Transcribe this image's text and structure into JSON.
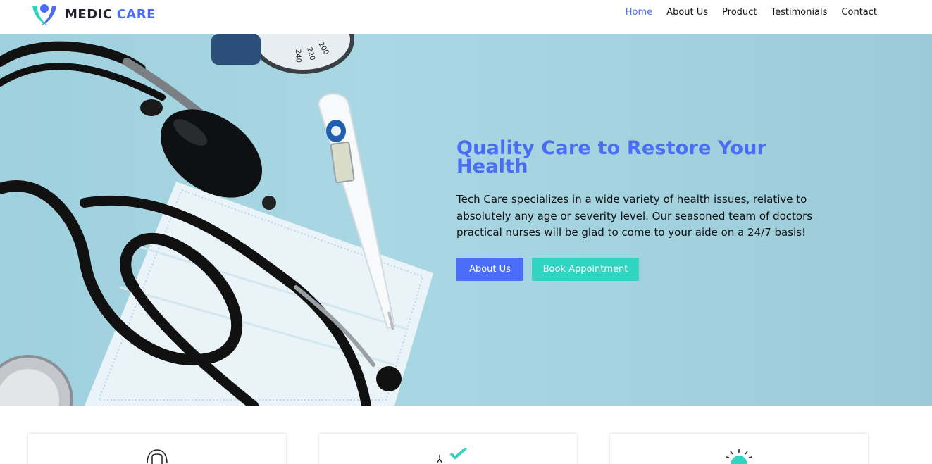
{
  "brand": {
    "name_part1": "MEDIC",
    "name_part2": "CARE",
    "logo_icon": "medic-care-logo-icon",
    "colors": {
      "primary": "#4a6cf7",
      "accent": "#2fd5c0",
      "dark": "#1f1f2e"
    }
  },
  "nav": {
    "items": [
      {
        "label": "Home",
        "active": true
      },
      {
        "label": "About Us",
        "active": false
      },
      {
        "label": "Product",
        "active": false
      },
      {
        "label": "Testimonials",
        "active": false
      },
      {
        "label": "Contact",
        "active": false
      }
    ]
  },
  "hero": {
    "title": "Quality Care to Restore Your Health",
    "description": "Tech Care specializes in a wide variety of health issues, relative to absolutely any age or severity level. Our seasoned team of doctors practical nurses will be glad to come to your aide on a 24/7 basis!",
    "buttons": {
      "primary_label": "About Us",
      "secondary_label": "Book Appointment"
    },
    "image_subject": "stethoscope, blood pressure gauge, thermometer and face mask",
    "gauge_labels": [
      "200",
      "220",
      "240"
    ]
  },
  "features": {
    "cards": [
      {
        "icon": "doctor-icon"
      },
      {
        "icon": "checkmark-icon"
      },
      {
        "icon": "lightbulb-icon"
      }
    ]
  }
}
